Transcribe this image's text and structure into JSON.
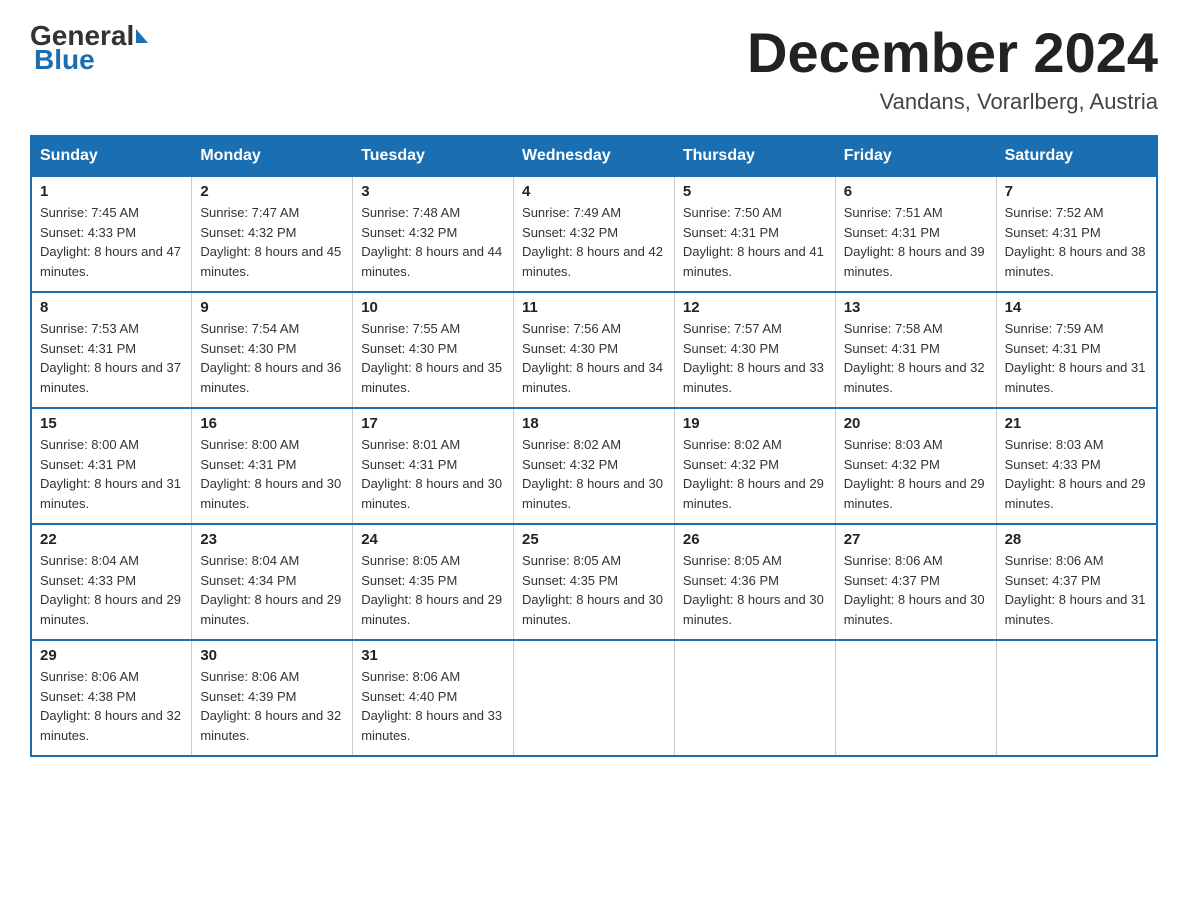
{
  "logo": {
    "general": "General",
    "blue": "Blue"
  },
  "title": "December 2024",
  "location": "Vandans, Vorarlberg, Austria",
  "days_of_week": [
    "Sunday",
    "Monday",
    "Tuesday",
    "Wednesday",
    "Thursday",
    "Friday",
    "Saturday"
  ],
  "weeks": [
    [
      {
        "day": "1",
        "sunrise": "7:45 AM",
        "sunset": "4:33 PM",
        "daylight": "8 hours and 47 minutes."
      },
      {
        "day": "2",
        "sunrise": "7:47 AM",
        "sunset": "4:32 PM",
        "daylight": "8 hours and 45 minutes."
      },
      {
        "day": "3",
        "sunrise": "7:48 AM",
        "sunset": "4:32 PM",
        "daylight": "8 hours and 44 minutes."
      },
      {
        "day": "4",
        "sunrise": "7:49 AM",
        "sunset": "4:32 PM",
        "daylight": "8 hours and 42 minutes."
      },
      {
        "day": "5",
        "sunrise": "7:50 AM",
        "sunset": "4:31 PM",
        "daylight": "8 hours and 41 minutes."
      },
      {
        "day": "6",
        "sunrise": "7:51 AM",
        "sunset": "4:31 PM",
        "daylight": "8 hours and 39 minutes."
      },
      {
        "day": "7",
        "sunrise": "7:52 AM",
        "sunset": "4:31 PM",
        "daylight": "8 hours and 38 minutes."
      }
    ],
    [
      {
        "day": "8",
        "sunrise": "7:53 AM",
        "sunset": "4:31 PM",
        "daylight": "8 hours and 37 minutes."
      },
      {
        "day": "9",
        "sunrise": "7:54 AM",
        "sunset": "4:30 PM",
        "daylight": "8 hours and 36 minutes."
      },
      {
        "day": "10",
        "sunrise": "7:55 AM",
        "sunset": "4:30 PM",
        "daylight": "8 hours and 35 minutes."
      },
      {
        "day": "11",
        "sunrise": "7:56 AM",
        "sunset": "4:30 PM",
        "daylight": "8 hours and 34 minutes."
      },
      {
        "day": "12",
        "sunrise": "7:57 AM",
        "sunset": "4:30 PM",
        "daylight": "8 hours and 33 minutes."
      },
      {
        "day": "13",
        "sunrise": "7:58 AM",
        "sunset": "4:31 PM",
        "daylight": "8 hours and 32 minutes."
      },
      {
        "day": "14",
        "sunrise": "7:59 AM",
        "sunset": "4:31 PM",
        "daylight": "8 hours and 31 minutes."
      }
    ],
    [
      {
        "day": "15",
        "sunrise": "8:00 AM",
        "sunset": "4:31 PM",
        "daylight": "8 hours and 31 minutes."
      },
      {
        "day": "16",
        "sunrise": "8:00 AM",
        "sunset": "4:31 PM",
        "daylight": "8 hours and 30 minutes."
      },
      {
        "day": "17",
        "sunrise": "8:01 AM",
        "sunset": "4:31 PM",
        "daylight": "8 hours and 30 minutes."
      },
      {
        "day": "18",
        "sunrise": "8:02 AM",
        "sunset": "4:32 PM",
        "daylight": "8 hours and 30 minutes."
      },
      {
        "day": "19",
        "sunrise": "8:02 AM",
        "sunset": "4:32 PM",
        "daylight": "8 hours and 29 minutes."
      },
      {
        "day": "20",
        "sunrise": "8:03 AM",
        "sunset": "4:32 PM",
        "daylight": "8 hours and 29 minutes."
      },
      {
        "day": "21",
        "sunrise": "8:03 AM",
        "sunset": "4:33 PM",
        "daylight": "8 hours and 29 minutes."
      }
    ],
    [
      {
        "day": "22",
        "sunrise": "8:04 AM",
        "sunset": "4:33 PM",
        "daylight": "8 hours and 29 minutes."
      },
      {
        "day": "23",
        "sunrise": "8:04 AM",
        "sunset": "4:34 PM",
        "daylight": "8 hours and 29 minutes."
      },
      {
        "day": "24",
        "sunrise": "8:05 AM",
        "sunset": "4:35 PM",
        "daylight": "8 hours and 29 minutes."
      },
      {
        "day": "25",
        "sunrise": "8:05 AM",
        "sunset": "4:35 PM",
        "daylight": "8 hours and 30 minutes."
      },
      {
        "day": "26",
        "sunrise": "8:05 AM",
        "sunset": "4:36 PM",
        "daylight": "8 hours and 30 minutes."
      },
      {
        "day": "27",
        "sunrise": "8:06 AM",
        "sunset": "4:37 PM",
        "daylight": "8 hours and 30 minutes."
      },
      {
        "day": "28",
        "sunrise": "8:06 AM",
        "sunset": "4:37 PM",
        "daylight": "8 hours and 31 minutes."
      }
    ],
    [
      {
        "day": "29",
        "sunrise": "8:06 AM",
        "sunset": "4:38 PM",
        "daylight": "8 hours and 32 minutes."
      },
      {
        "day": "30",
        "sunrise": "8:06 AM",
        "sunset": "4:39 PM",
        "daylight": "8 hours and 32 minutes."
      },
      {
        "day": "31",
        "sunrise": "8:06 AM",
        "sunset": "4:40 PM",
        "daylight": "8 hours and 33 minutes."
      },
      null,
      null,
      null,
      null
    ]
  ],
  "labels": {
    "sunrise": "Sunrise:",
    "sunset": "Sunset:",
    "daylight": "Daylight:"
  }
}
